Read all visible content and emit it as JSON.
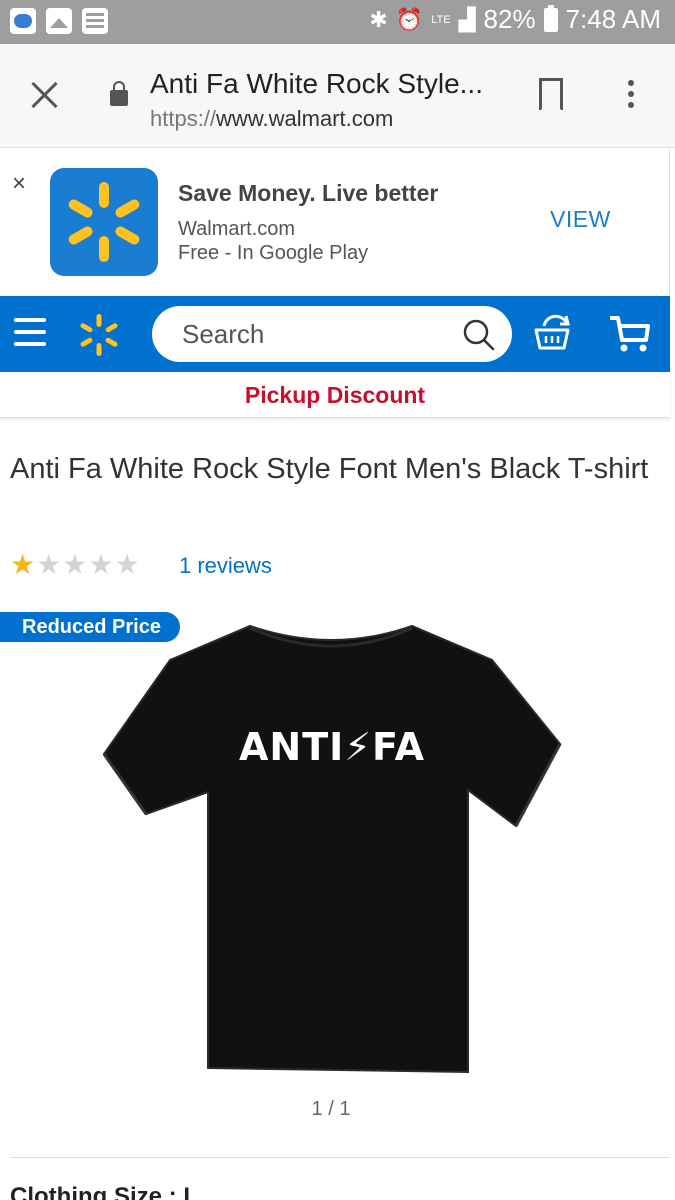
{
  "status_bar": {
    "battery": "82%",
    "time": "7:48 AM",
    "network": "LTE",
    "icons": [
      "browser-icon",
      "gallery-icon",
      "news-icon",
      "bluetooth-icon",
      "alarm-icon",
      "signal-icon",
      "battery-icon"
    ]
  },
  "browser": {
    "page_title": "Anti Fa White Rock Style...",
    "url_scheme": "https://",
    "url_host": "www.walmart.com"
  },
  "app_banner": {
    "close": "×",
    "title": "Save Money. Live better",
    "publisher": "Walmart.com",
    "price_line": "Free - In Google Play",
    "action": "VIEW"
  },
  "nav": {
    "search_placeholder": "Search"
  },
  "promo": {
    "text": "Pickup Discount"
  },
  "product": {
    "title": "Anti Fa White Rock Style Font Men's Black T-shirt",
    "rating": 1,
    "rating_max": 5,
    "reviews_label": "1 reviews",
    "badge": "Reduced Price",
    "shirt_print": "ANTI⚡FA",
    "image_index": "1 / 1",
    "size_label": "Clothing Size : L"
  },
  "colors": {
    "walmart_blue": "#0071ce",
    "spark_yellow": "#ffc220",
    "promo_red": "#c8102e",
    "star_gold": "#f8b517"
  }
}
